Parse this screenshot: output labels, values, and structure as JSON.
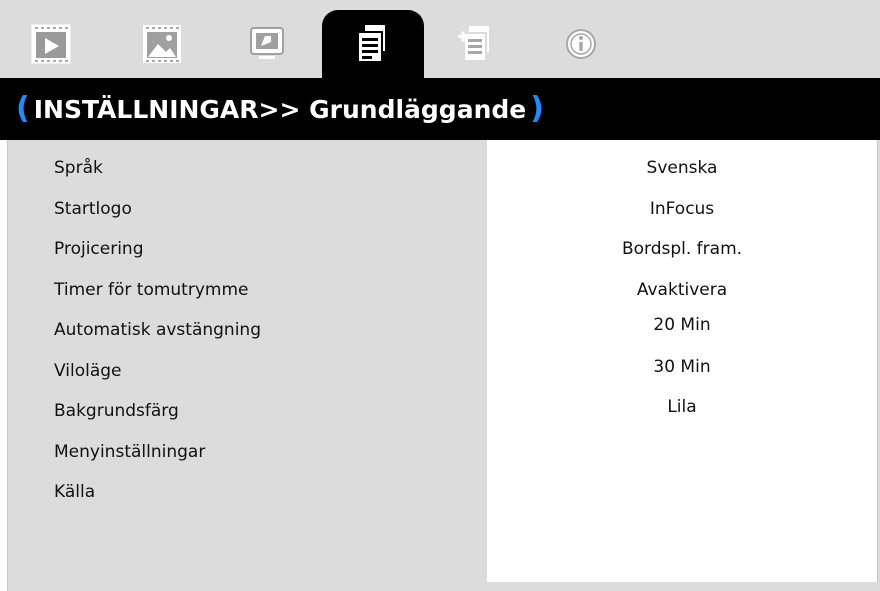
{
  "tabs": [
    {
      "name": "image-tab",
      "icon": "play-screen-icon",
      "active": false
    },
    {
      "name": "display-tab",
      "icon": "picture-icon",
      "active": false
    },
    {
      "name": "3d-tab",
      "icon": "screen-arrow-icon",
      "active": false
    },
    {
      "name": "settings-basic-tab",
      "icon": "document-gear-icon",
      "active": true
    },
    {
      "name": "settings-advanced-tab",
      "icon": "document-plus-icon",
      "active": false
    },
    {
      "name": "info-tab",
      "icon": "info-icon",
      "active": false
    }
  ],
  "title": {
    "open_paren": "(",
    "text": "INSTÄLLNINGAR>> Grundläggande",
    "close_paren": ")"
  },
  "menu": {
    "items": [
      {
        "label": "Språk",
        "value": "Svenska"
      },
      {
        "label": "Startlogo",
        "value": "InFocus"
      },
      {
        "label": "Projicering",
        "value": "Bordspl. fram."
      },
      {
        "label": "Timer för tomutrymme",
        "value": "Avaktivera"
      },
      {
        "label": "Automatisk avstängning",
        "value": "20 Min"
      },
      {
        "label": "Viloläge",
        "value": "30 Min"
      },
      {
        "label": "Bakgrundsfärg",
        "value": "Lila"
      },
      {
        "label": "Menyinställningar",
        "value": ""
      },
      {
        "label": "Källa",
        "value": ""
      }
    ]
  },
  "colors": {
    "tabbar_bg": "#dcdcdc",
    "active_tab_bg": "#000000",
    "title_bg": "#000000",
    "title_text": "#ffffff",
    "paren_accent": "#1e8cff",
    "label_panel_bg": "#dcdcdc",
    "value_panel_bg": "#ffffff"
  }
}
